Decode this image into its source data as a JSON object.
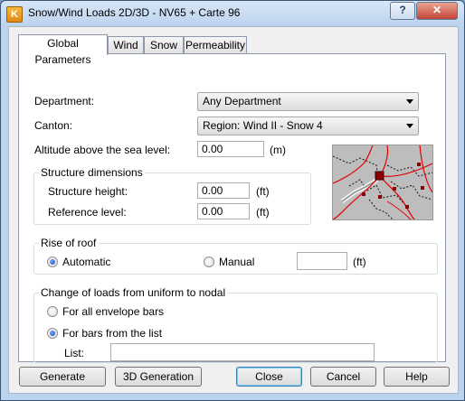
{
  "window": {
    "title": "Snow/Wind Loads 2D/3D - NV65 + Carte 96",
    "app_icon_letter": "K",
    "help_button": "?",
    "close_glyph": "✕"
  },
  "tabs": [
    {
      "label": "Global Parameters",
      "active": true
    },
    {
      "label": "Wind",
      "active": false
    },
    {
      "label": "Snow",
      "active": false
    },
    {
      "label": "Permeability",
      "active": false
    }
  ],
  "general": {
    "department_label": "Department:",
    "department_value": "Any Department",
    "canton_label": "Canton:",
    "canton_value": "Region: Wind II - Snow 4",
    "altitude_label": "Altitude above the sea level:",
    "altitude_value": "0.00",
    "altitude_unit": "(m)"
  },
  "structure": {
    "title": "Structure dimensions",
    "height_label": "Structure height:",
    "height_value": "0.00",
    "height_unit": "(ft)",
    "reference_label": "Reference level:",
    "reference_value": "0.00",
    "reference_unit": "(ft)"
  },
  "roof": {
    "title": "Rise of roof",
    "automatic_label": "Automatic",
    "automatic_selected": true,
    "manual_label": "Manual",
    "manual_selected": false,
    "manual_value": "",
    "manual_unit": "(ft)"
  },
  "loads": {
    "title": "Change of loads from uniform to nodal",
    "all_bars_label": "For all envelope bars",
    "all_bars_selected": false,
    "list_bars_label": "For bars from the list",
    "list_bars_selected": true,
    "list_label": "List:",
    "list_value": ""
  },
  "buttons": {
    "generate": "Generate",
    "generation_3d": "3D Generation",
    "close": "Close",
    "cancel": "Cancel",
    "help": "Help"
  },
  "colors": {
    "title_bar": "#bcd3ee",
    "map_region_lines": "#e00000",
    "map_selected_node": "#8b0000",
    "radio_selected": "#1c4ea8"
  }
}
